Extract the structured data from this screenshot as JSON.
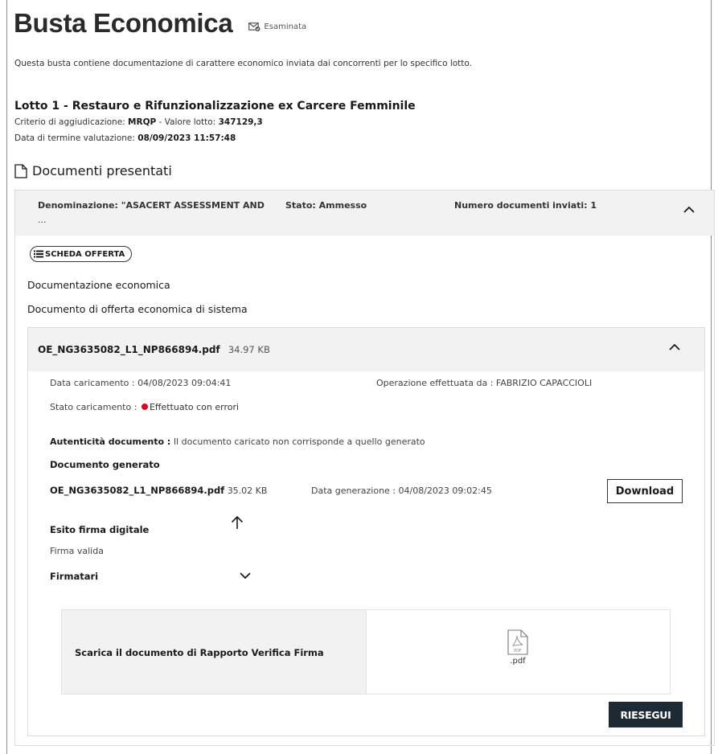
{
  "page": {
    "title": "Busta Economica",
    "status_badge": "Esaminata",
    "description": "Questa busta contiene documentazione di carattere economico inviata dai concorrenti per lo specifico lotto."
  },
  "lotto": {
    "title": "Lotto 1 - Restauro e Rifunzionalizzazione ex Carcere Femminile",
    "criterio_label": "Criterio di aggiudicazione:",
    "criterio_value": "MRQP",
    "valore_label": "- Valore lotto:",
    "valore_value": "347129,3",
    "termine_label": "Data di termine valutazione:",
    "termine_value": "08/09/2023 11:57:48"
  },
  "documenti": {
    "heading": "Documenti presentati",
    "concorrente": {
      "denominazione": "Denominazione: \"ASACERT ASSESSMENT AND",
      "denominazione_more": "...",
      "stato": "Stato: Ammesso",
      "numero": "Numero documenti inviati: 1",
      "scheda_button": "SCHEDA OFFERTA",
      "doc_economica": "Documentazione economica",
      "doc_offerta": "Documento di offerta economica di sistema",
      "file": {
        "name": "OE_NG3635082_L1_NP866894.pdf",
        "size": "34.97 KB",
        "data_caricamento": "Data caricamento : 04/08/2023 09:04:41",
        "operazione": "Operazione effettuata da : FABRIZIO CAPACCIOLI",
        "stato_caricamento_label": "Stato caricamento :",
        "stato_caricamento_value": "Effettuato con errori",
        "autenticita_label": "Autenticità documento :",
        "autenticita_value": "Il documento caricato non corrisponde a quello generato",
        "doc_generato_label": "Documento generato",
        "gen_name": "OE_NG3635082_L1_NP866894.pdf",
        "gen_size": "35.02 KB",
        "data_generazione": "Data generazione : 04/08/2023 09:02:45",
        "download_button": "Download",
        "esito_label": "Esito firma digitale",
        "esito_value": "Firma valida",
        "firmatari_label": "Firmatari",
        "report_label": "Scarica il documento di Rapporto Verifica Firma",
        "report_ext": ".pdf",
        "pdf_icon_text": "PDF",
        "riesegui_button": "RIESEGUI"
      }
    }
  },
  "colors": {
    "error_dot": "#e3001b",
    "header_bg": "#f2f2f2",
    "dark_button": "#1e2a33"
  },
  "icons": [
    "envelope-check-icon",
    "document-icon",
    "chevron-up-icon",
    "list-icon",
    "arrow-up-icon",
    "chevron-down-icon",
    "pdf-file-icon"
  ]
}
